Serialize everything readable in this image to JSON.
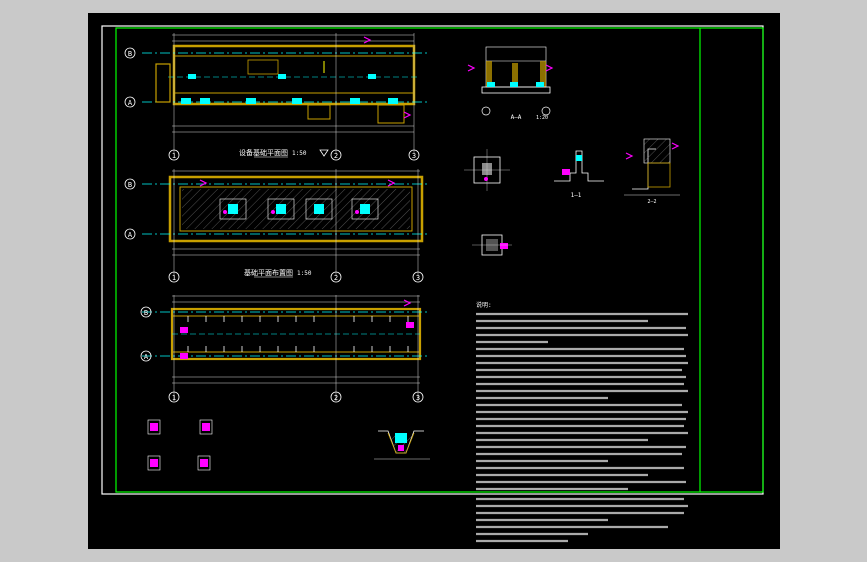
{
  "colors": {
    "canvas": "#000000",
    "backdrop": "#c9c9c9",
    "border_white": "#ffffff",
    "frame_green": "#00ff00",
    "wall_yellow": "#c8a000",
    "axis_cyan": "#00ffff",
    "dim_lines": "#d8d8d8",
    "magenta": "#ff00ff",
    "hatch_gray": "#8a8a8a"
  },
  "plans": [
    {
      "name": "plan-1",
      "title": "设备基础平面图",
      "scale": "1:50"
    },
    {
      "name": "plan-2",
      "title": "基础平面布置图",
      "scale": "1:50"
    },
    {
      "name": "plan-3",
      "title": "",
      "scale": ""
    }
  ],
  "axes": {
    "rows": [
      "B",
      "A"
    ],
    "cols": [
      "1",
      "2",
      "3"
    ]
  },
  "details": {
    "section_a": {
      "title": "A—A",
      "scale": "1:20"
    },
    "section_1": {
      "title": "1—1",
      "scale": ""
    },
    "section_2": {
      "title": "2—2",
      "scale": ""
    }
  },
  "notes": {
    "heading": "说明:"
  },
  "icons": {
    "north_marker": "triangle-icon"
  }
}
